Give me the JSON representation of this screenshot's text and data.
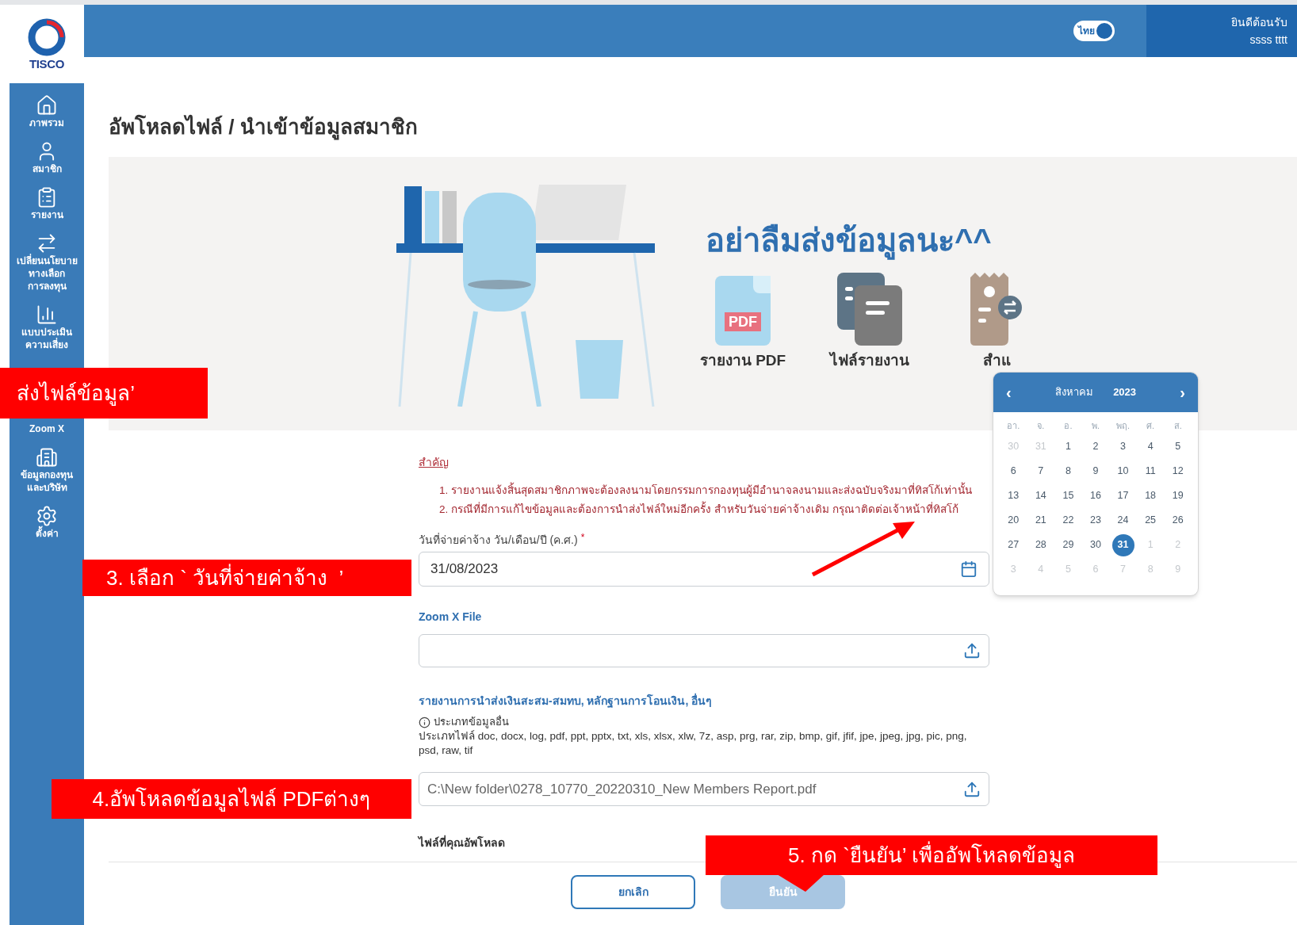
{
  "header": {
    "language_toggle": {
      "label": "ไทย",
      "on": true
    },
    "greeting": "ยินดีต้อนรับ",
    "user": "ssss tttt"
  },
  "logo": {
    "text": "TISCO"
  },
  "sidebar": {
    "items": [
      {
        "lines": [
          "ภาพรวม"
        ]
      },
      {
        "lines": [
          "สมาชิก"
        ]
      },
      {
        "lines": [
          "รายงาน"
        ]
      },
      {
        "lines": [
          "เปลี่ยนนโยบาย",
          "ทางเลือก",
          "การลงทุน"
        ]
      },
      {
        "lines": [
          "แบบประเมิน",
          "ความเสี่ยง"
        ]
      },
      {
        "lines": [
          "Zoom X"
        ]
      },
      {
        "lines": [
          "ข้อมูลกองทุน",
          "และบริษัท"
        ]
      },
      {
        "lines": [
          "ตั้งค่า"
        ]
      }
    ]
  },
  "page_title": "อัพโหลดไฟล์ / นำเข้าข้อมูลสมาชิก",
  "banner": {
    "headline": "อย่าลืมส่งข้อมูลนะ^^",
    "cards": [
      {
        "kind": "pdf",
        "label": "รายงาน PDF",
        "badge": "PDF"
      },
      {
        "kind": "files",
        "label": "ไฟล์รายงาน"
      },
      {
        "kind": "receipt",
        "label": "สำแ"
      }
    ]
  },
  "notice": {
    "title": "สำคัญ",
    "items": [
      "1. รายงานแจ้งสิ้นสุดสมาชิกภาพจะต้องลงนามโดยกรรมการกองทุนผู้มีอำนาจลงนามและส่งฉบับจริงมาที่ทิสโก้เท่านั้น",
      "2. กรณีที่มีการแก้ไขข้อมูลและต้องการนำส่งไฟล์ใหม่อีกครั้ง สำหรับวันจ่ายค่าจ้างเดิม กรุณาติดต่อเจ้าหน้าที่ทิสโก้"
    ]
  },
  "pay_date": {
    "label": "วันที่จ่ายค่าจ้าง วัน/เดือน/ปี (ค.ศ.)",
    "required_mark": "*",
    "value": "31/08/2023"
  },
  "zoom_file": {
    "label": "Zoom X File"
  },
  "other_file": {
    "label": "รายงานการนำส่งเงินสะสม-สมทบ, หลักฐานการโอนเงิน, อื่นๆ",
    "info": "ประเภทข้อมูลอื่น",
    "types": "ประเภทไฟล์ doc, docx, log, pdf, ppt, pptx, txt, xls, xlsx, xlw, 7z, asp, prg, rar, zip, bmp, gif, jfif, jpe, jpeg, jpg, pic, png, psd, raw, tif",
    "value": "C:\\New folder\\0278_10770_20220310_New Members Report.pdf"
  },
  "uploaded_label": "ไฟล์ที่คุณอัพโหลด",
  "buttons": [
    {
      "label": "ยกเลิก",
      "kind": "outline",
      "disabled": false
    },
    {
      "label": "ยืนยัน",
      "kind": "primary",
      "disabled": true
    }
  ],
  "calendar": {
    "prev": "‹",
    "next": "›",
    "month": "สิงหาคม",
    "year": "2023",
    "weekdays": [
      "อา.",
      "จ.",
      "อ.",
      "พ.",
      "พฤ.",
      "ศ.",
      "ส."
    ],
    "days": [
      {
        "label": "30",
        "outside": true,
        "selected": false
      },
      {
        "label": "31",
        "outside": true,
        "selected": false
      },
      {
        "label": "1",
        "outside": false,
        "selected": false
      },
      {
        "label": "2",
        "outside": false,
        "selected": false
      },
      {
        "label": "3",
        "outside": false,
        "selected": false
      },
      {
        "label": "4",
        "outside": false,
        "selected": false
      },
      {
        "label": "5",
        "outside": false,
        "selected": false
      },
      {
        "label": "6",
        "outside": false,
        "selected": false
      },
      {
        "label": "7",
        "outside": false,
        "selected": false
      },
      {
        "label": "8",
        "outside": false,
        "selected": false
      },
      {
        "label": "9",
        "outside": false,
        "selected": false
      },
      {
        "label": "10",
        "outside": false,
        "selected": false
      },
      {
        "label": "11",
        "outside": false,
        "selected": false
      },
      {
        "label": "12",
        "outside": false,
        "selected": false
      },
      {
        "label": "13",
        "outside": false,
        "selected": false
      },
      {
        "label": "14",
        "outside": false,
        "selected": false
      },
      {
        "label": "15",
        "outside": false,
        "selected": false
      },
      {
        "label": "16",
        "outside": false,
        "selected": false
      },
      {
        "label": "17",
        "outside": false,
        "selected": false
      },
      {
        "label": "18",
        "outside": false,
        "selected": false
      },
      {
        "label": "19",
        "outside": false,
        "selected": false
      },
      {
        "label": "20",
        "outside": false,
        "selected": false
      },
      {
        "label": "21",
        "outside": false,
        "selected": false
      },
      {
        "label": "22",
        "outside": false,
        "selected": false
      },
      {
        "label": "23",
        "outside": false,
        "selected": false
      },
      {
        "label": "24",
        "outside": false,
        "selected": false
      },
      {
        "label": "25",
        "outside": false,
        "selected": false
      },
      {
        "label": "26",
        "outside": false,
        "selected": false
      },
      {
        "label": "27",
        "outside": false,
        "selected": false
      },
      {
        "label": "28",
        "outside": false,
        "selected": false
      },
      {
        "label": "29",
        "outside": false,
        "selected": false
      },
      {
        "label": "30",
        "outside": false,
        "selected": false
      },
      {
        "label": "31",
        "outside": false,
        "selected": true
      },
      {
        "label": "1",
        "outside": true,
        "selected": false
      },
      {
        "label": "2",
        "outside": true,
        "selected": false
      },
      {
        "label": "3",
        "outside": true,
        "selected": false
      },
      {
        "label": "4",
        "outside": true,
        "selected": false
      },
      {
        "label": "5",
        "outside": true,
        "selected": false
      },
      {
        "label": "6",
        "outside": true,
        "selected": false
      },
      {
        "label": "7",
        "outside": true,
        "selected": false
      },
      {
        "label": "8",
        "outside": true,
        "selected": false
      },
      {
        "label": "9",
        "outside": true,
        "selected": false
      }
    ]
  },
  "callouts": [
    "ส่งไฟล์ข้อมูล’",
    "3. เลือก ` วันที่จ่ายค่าจ้าง  ’",
    "4.อัพโหลดข้อมูลไฟล์ PDFต่างๆ",
    "5. กด `ยืนยัน’ เพื่ออัพโหลดข้อมูล"
  ]
}
